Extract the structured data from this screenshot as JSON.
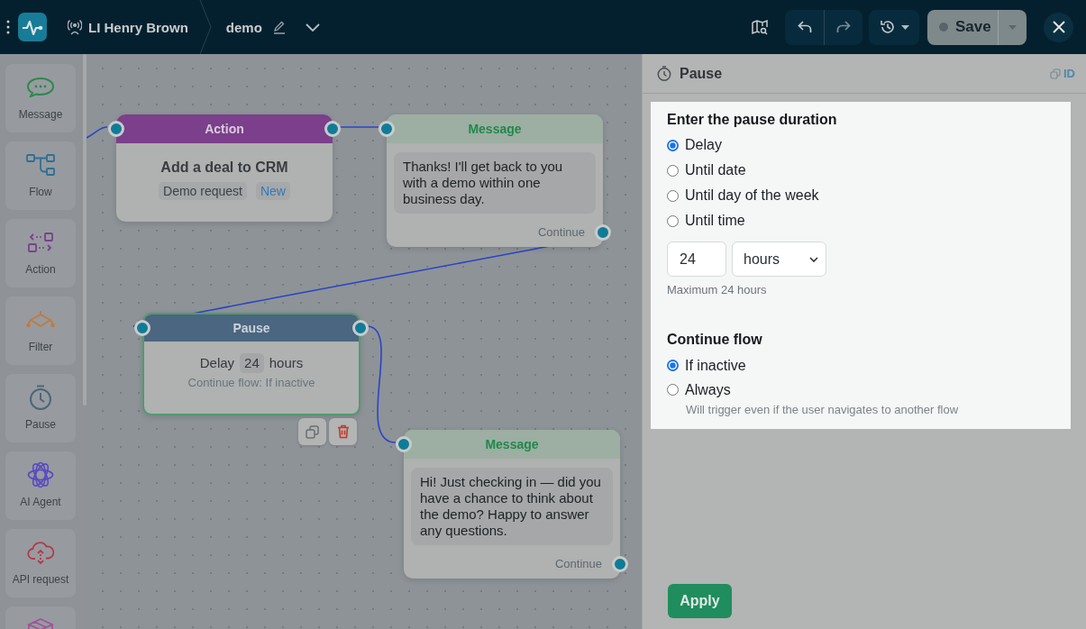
{
  "top_bar": {
    "workspace": "LI Henry Brown",
    "flow_name": "demo",
    "save_label": "Save"
  },
  "sidebar": {
    "items": [
      {
        "kind": "message",
        "label": "Message"
      },
      {
        "kind": "flow",
        "label": "Flow"
      },
      {
        "kind": "action",
        "label": "Action"
      },
      {
        "kind": "filter",
        "label": "Filter"
      },
      {
        "kind": "pause",
        "label": "Pause"
      },
      {
        "kind": "ai_agent",
        "label": "AI Agent"
      },
      {
        "kind": "api_request",
        "label": "API request"
      },
      {
        "kind": "package"
      }
    ]
  },
  "canvas": {
    "nodes": [
      {
        "kind": "action",
        "title": "Action",
        "selected": false,
        "heading": "Add a deal to CRM",
        "tags": [
          {
            "text": "Demo request",
            "color": "#3b4245"
          },
          {
            "text": "New",
            "color": "#2f7bbf"
          }
        ]
      },
      {
        "kind": "message",
        "title": "Message",
        "selected": false,
        "text": "Thanks! I'll get back to you with a demo within one business day.",
        "output": "Continue"
      },
      {
        "kind": "pause",
        "title": "Pause",
        "selected": true,
        "label": "Delay",
        "value": "24",
        "unit": "hours",
        "subtitle": "Continue flow: If inactive"
      },
      {
        "kind": "message",
        "title": "Message",
        "selected": false,
        "text": "Hi! Just checking in — did you have a chance to think about the demo? Happy to answer any questions.",
        "output": "Continue"
      }
    ]
  },
  "panel": {
    "title": "Pause",
    "id_label": "ID",
    "duration": {
      "heading": "Enter the pause duration",
      "options": [
        {
          "label": "Delay",
          "selected": true
        },
        {
          "label": "Until date",
          "selected": false
        },
        {
          "label": "Until day of the week",
          "selected": false
        },
        {
          "label": "Until time",
          "selected": false
        }
      ],
      "amount": "24",
      "unit": "hours",
      "hint": "Maximum 24 hours"
    },
    "continue_flow": {
      "heading": "Continue flow",
      "options": [
        {
          "label": "If inactive",
          "selected": true
        },
        {
          "label": "Always",
          "selected": false,
          "description": "Will trigger even if the user navigates to another flow"
        }
      ]
    },
    "apply_label": "Apply"
  }
}
